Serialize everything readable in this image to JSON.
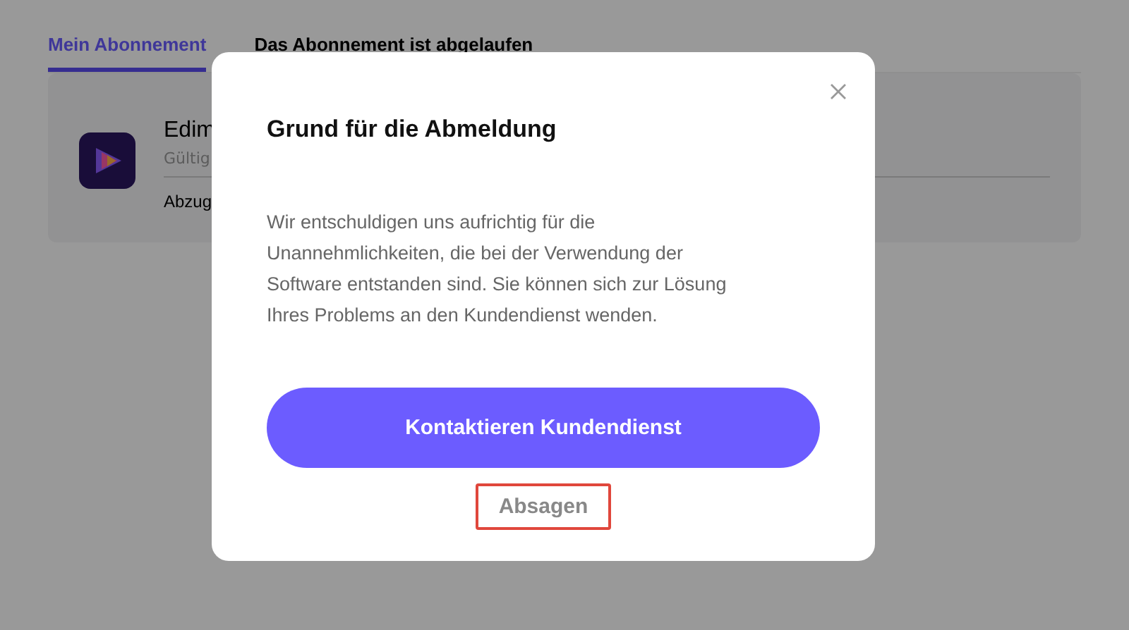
{
  "tabs": [
    {
      "label": "Mein Abonnement",
      "selected": true
    },
    {
      "label": "Das Abonnement ist abgelaufen",
      "selected": false
    }
  ],
  "subscription": {
    "name": "Edim",
    "validity": "Gültig",
    "deduction": "Abzug"
  },
  "dialog": {
    "title": "Grund für die Abmeldung",
    "message": "Wir entschuldigen uns aufrichtig für die Unannehmlichkeiten, die bei der Verwendung der Software entstanden sind. Sie können sich zur Lösung Ihres Problems an den Kundendienst wenden.",
    "primary_button": "Kontaktieren Kundendienst",
    "cancel_button": {
      "label": "Absagen",
      "highlighted": true
    }
  }
}
